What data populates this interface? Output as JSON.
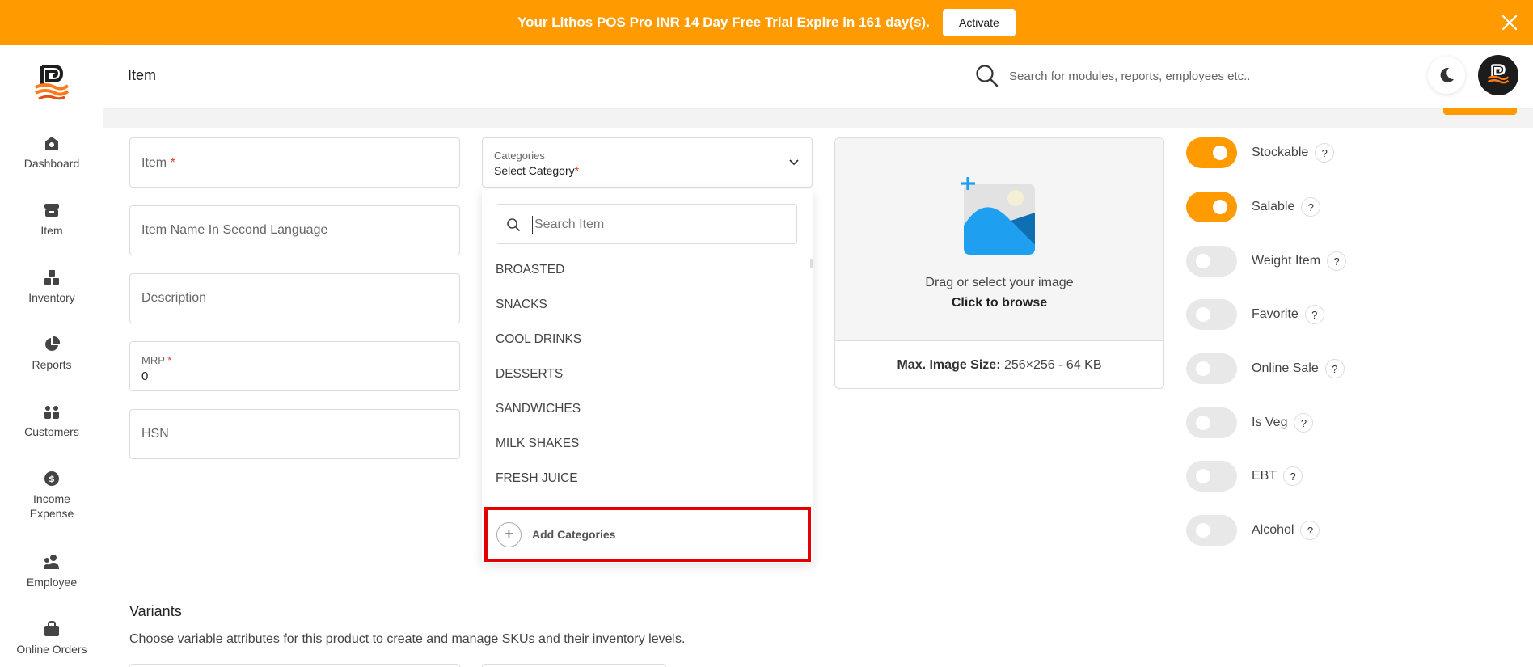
{
  "banner": {
    "message": "Your Lithos POS Pro INR 14 Day Free Trial Expire in 161 day(s).",
    "activate_label": "Activate",
    "color": "#ff9a00"
  },
  "sidebar": {
    "items": [
      {
        "label": "Dashboard",
        "icon": "dashboard-icon"
      },
      {
        "label": "Item",
        "icon": "item-box-icon"
      },
      {
        "label": "Inventory",
        "icon": "inventory-icon"
      },
      {
        "label": "Reports",
        "icon": "pie-chart-icon"
      },
      {
        "label": "Customers",
        "icon": "customers-icon"
      },
      {
        "label": "Income\nExpense",
        "label_line1": "Income",
        "label_line2": "Expense",
        "icon": "dollar-icon"
      },
      {
        "label": "Employee",
        "icon": "employee-icon"
      },
      {
        "label": "Online Orders",
        "icon": "shopping-bag-icon"
      }
    ]
  },
  "header": {
    "title": "Item",
    "search_placeholder": "Search for modules, reports, employees etc.."
  },
  "form": {
    "item_placeholder": "Item",
    "second_language_placeholder": "Item Name In Second Language",
    "description_placeholder": "Description",
    "mrp_label": "MRP",
    "mrp_value": "0",
    "hsn_placeholder": "HSN",
    "required_mark": "*"
  },
  "categories": {
    "label": "Categories",
    "selected": "Select Category",
    "search_placeholder": "Search Item",
    "options": [
      "BROASTED",
      "SNACKS",
      "COOL DRINKS",
      "DESSERTS",
      "SANDWICHES",
      "MILK SHAKES",
      "FRESH JUICE"
    ],
    "add_label": "Add Categories"
  },
  "image_upload": {
    "drag_text": "Drag or select your image",
    "browse_text": "Click to browse",
    "max_size_label": "Max. Image Size:",
    "max_size_value": "256×256 - 64 KB"
  },
  "toggles": [
    {
      "label": "Stockable",
      "on": true
    },
    {
      "label": "Salable",
      "on": true
    },
    {
      "label": "Weight Item",
      "on": false
    },
    {
      "label": "Favorite",
      "on": false
    },
    {
      "label": "Online Sale",
      "on": false
    },
    {
      "label": "Is Veg",
      "on": false
    },
    {
      "label": "EBT",
      "on": false
    },
    {
      "label": "Alcohol",
      "on": false
    }
  ],
  "help_mark": "?",
  "variants": {
    "title": "Variants",
    "description": "Choose variable attributes for this product to create and manage SKUs and their inventory levels."
  },
  "colors": {
    "accent": "#ff9a00",
    "highlight": "#e40000"
  }
}
